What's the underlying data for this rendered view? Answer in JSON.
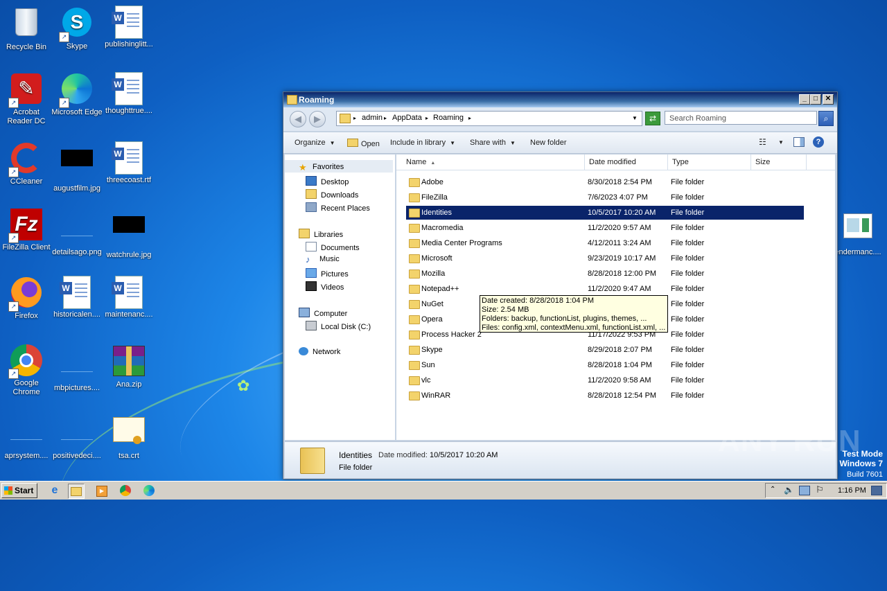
{
  "desktop": {
    "icons": [
      {
        "label": "Recycle Bin",
        "icon": "recycle-bin-icon"
      },
      {
        "label": "Skype",
        "icon": "skype-icon"
      },
      {
        "label": "publishinglitt...",
        "icon": "word-doc-icon"
      },
      {
        "label": "Acrobat Reader DC",
        "icon": "acrobat-icon"
      },
      {
        "label": "Microsoft Edge",
        "icon": "edge-icon"
      },
      {
        "label": "thoughttrue....",
        "icon": "word-doc-icon"
      },
      {
        "label": "CCleaner",
        "icon": "ccleaner-icon"
      },
      {
        "label": "augustfilm.jpg",
        "icon": "image-icon"
      },
      {
        "label": "threecoast.rtf",
        "icon": "word-doc-icon"
      },
      {
        "label": "FileZilla Client",
        "icon": "filezilla-icon"
      },
      {
        "label": "detailsago.png",
        "icon": "image-icon"
      },
      {
        "label": "watchrule.jpg",
        "icon": "image-icon"
      },
      {
        "label": "Firefox",
        "icon": "firefox-icon"
      },
      {
        "label": "historicalen....",
        "icon": "word-doc-icon"
      },
      {
        "label": "maintenanc....",
        "icon": "word-doc-icon"
      },
      {
        "label": "Google Chrome",
        "icon": "chrome-icon"
      },
      {
        "label": "mbpictures....",
        "icon": "image-icon"
      },
      {
        "label": "Ana.zip",
        "icon": "winrar-archive-icon"
      },
      {
        "label": "aprsystem....",
        "icon": "file-icon"
      },
      {
        "label": "positivedeci....",
        "icon": "file-icon"
      },
      {
        "label": "tsa.crt",
        "icon": "certificate-icon"
      },
      {
        "label": "endermanc....",
        "icon": "generic-file-icon"
      }
    ]
  },
  "window": {
    "title": "Roaming",
    "buttons": {
      "minimize": "_",
      "maximize": "□",
      "close": "✕"
    },
    "address": {
      "segments": [
        "admin",
        "AppData",
        "Roaming"
      ]
    },
    "search_placeholder": "Search Roaming",
    "toolbar": {
      "organize": "Organize",
      "open": "Open",
      "include_in_library": "Include in library",
      "share_with": "Share with",
      "new_folder": "New folder"
    },
    "nav": {
      "favorites": "Favorites",
      "desktop": "Desktop",
      "downloads": "Downloads",
      "recent_places": "Recent Places",
      "libraries": "Libraries",
      "documents": "Documents",
      "music": "Music",
      "pictures": "Pictures",
      "videos": "Videos",
      "computer": "Computer",
      "local_disk": "Local Disk (C:)",
      "network": "Network"
    },
    "columns": {
      "name": "Name",
      "date": "Date modified",
      "type": "Type",
      "size": "Size"
    },
    "files": [
      {
        "name": "Adobe",
        "date": "8/30/2018 2:54 PM",
        "type": "File folder"
      },
      {
        "name": "FileZilla",
        "date": "7/6/2023 4:07 PM",
        "type": "File folder"
      },
      {
        "name": "Identities",
        "date": "10/5/2017 10:20 AM",
        "type": "File folder"
      },
      {
        "name": "Macromedia",
        "date": "11/2/2020 9:57 AM",
        "type": "File folder"
      },
      {
        "name": "Media Center Programs",
        "date": "4/12/2011 3:24 AM",
        "type": "File folder"
      },
      {
        "name": "Microsoft",
        "date": "9/23/2019 10:17 AM",
        "type": "File folder"
      },
      {
        "name": "Mozilla",
        "date": "8/28/2018 12:00 PM",
        "type": "File folder"
      },
      {
        "name": "Notepad++",
        "date": "11/2/2020 9:47 AM",
        "type": "File folder"
      },
      {
        "name": "NuGet",
        "date": "",
        "type": "File folder"
      },
      {
        "name": "Opera",
        "date": "",
        "type": "File folder"
      },
      {
        "name": "Process Hacker 2",
        "date": "11/17/2022 9:53 PM",
        "type": "File folder"
      },
      {
        "name": "Skype",
        "date": "8/29/2018 2:07 PM",
        "type": "File folder"
      },
      {
        "name": "Sun",
        "date": "8/28/2018 1:04 PM",
        "type": "File folder"
      },
      {
        "name": "vlc",
        "date": "11/2/2020 9:58 AM",
        "type": "File folder"
      },
      {
        "name": "WinRAR",
        "date": "8/28/2018 12:54 PM",
        "type": "File folder"
      }
    ],
    "tooltip": {
      "created": "Date created: 8/28/2018 1:04 PM",
      "size": "Size: 2.54 MB",
      "folders": "Folders: backup, functionList, plugins, themes, ...",
      "files": "Files: config.xml, contextMenu.xml, functionList.xml, ..."
    },
    "details": {
      "name": "Identities",
      "date_label": "Date modified:",
      "date_value": "10/5/2017 10:20 AM",
      "type": "File folder"
    }
  },
  "taskbar": {
    "start": "Start",
    "clock": "1:16 PM"
  },
  "watermark": {
    "brand": "ANY RUN",
    "mode": "Test Mode",
    "os": "Windows 7",
    "build": "Build 7601"
  }
}
